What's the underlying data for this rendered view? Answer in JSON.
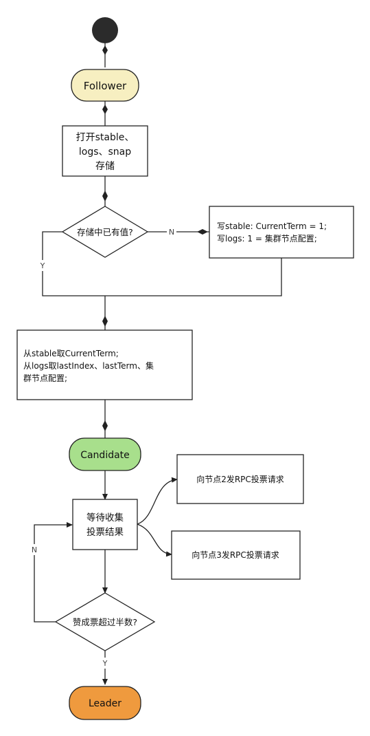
{
  "diagram": {
    "colors": {
      "follower": "#f7efc1",
      "candidate": "#a8df8c",
      "leader": "#ef9a3e",
      "start": "#2b2b2b",
      "line": "#222222"
    },
    "nodes": {
      "follower": "Follower",
      "open_store": [
        "打开stable、",
        "logs、snap",
        "存储"
      ],
      "has_value": "存储中已有值?",
      "write_init": [
        "写stable: CurrentTerm = 1;",
        "写logs: 1 = 集群节点配置;"
      ],
      "read_state": [
        "从stable取CurrentTerm;",
        "从logs取lastIndex、lastTerm、集",
        "群节点配置;"
      ],
      "candidate": "Candidate",
      "wait_votes": [
        "等待收集",
        "投票结果"
      ],
      "vote_node2": "向节点2发RPC投票请求",
      "vote_node3": "向节点3发RPC投票请求",
      "majority": "赞成票超过半数?",
      "leader": "Leader"
    },
    "edge_labels": {
      "has_value_no": "N",
      "has_value_yes": "Y",
      "majority_no": "N",
      "majority_yes": "Y"
    }
  }
}
